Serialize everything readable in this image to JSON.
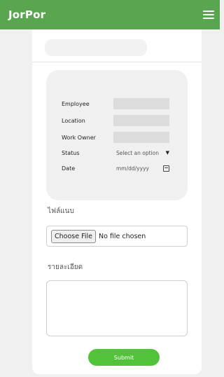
{
  "header": {
    "brand": "JorPor",
    "menu_icon": "hamburger-menu-icon"
  },
  "form": {
    "fields": [
      {
        "label": "Employee",
        "value": ""
      },
      {
        "label": "Location",
        "value": ""
      },
      {
        "label": "Work Owner",
        "value": ""
      },
      {
        "label": "Status",
        "placeholder": "Select an option"
      },
      {
        "label": "Date",
        "placeholder": "mm/dd/yyyy"
      }
    ],
    "attachment": {
      "label": "ไฟล์แนบ",
      "button": "Choose File",
      "status": "No file chosen"
    },
    "details": {
      "label": "รายละเอียด",
      "value": ""
    },
    "submit_label": "Submit"
  },
  "colors": {
    "header_bg": "#5aa650",
    "submit_bg": "#52c23a"
  }
}
